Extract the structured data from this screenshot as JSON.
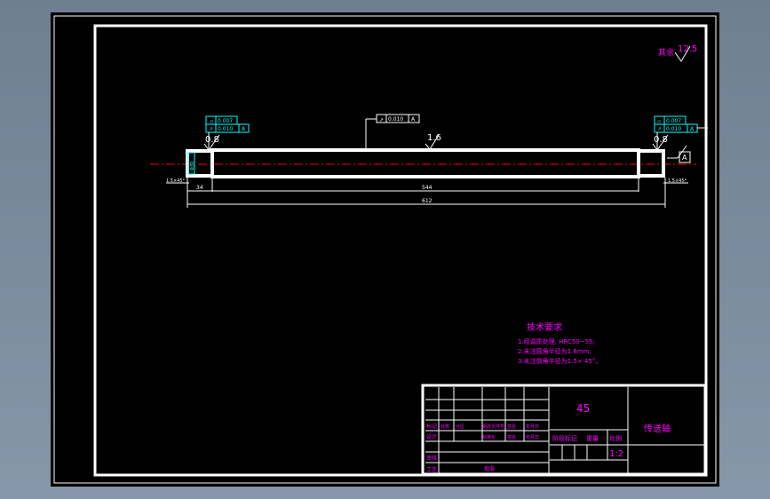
{
  "drawing": {
    "surface_note": {
      "label": "其余",
      "value": "12.5"
    },
    "tolerances": {
      "left_runout": "0.007",
      "left_cyl": "0.010",
      "left_datum": "A",
      "center_runout": "0.010",
      "center_datum": "A",
      "right_runout": "0.007",
      "right_cyl": "0.010",
      "right_datum": "A",
      "datum_label": "A"
    },
    "roughness": {
      "left": "0.8",
      "center": "1.6",
      "right": "0.8"
    },
    "dimensions": {
      "left_len": "34",
      "body_len": "544",
      "total_len": "612",
      "left_chamfer": "1.5×45°",
      "right_chamfer": "1.5×45°",
      "left_dia": "Φ30"
    }
  },
  "tech_requirements": {
    "title": "技术要求",
    "items": [
      "1.经调质处理,  HRC50~55;",
      "2.未注圆角半径为1.6mm;",
      "3.未注倒角半径为1.5× 45°。"
    ]
  },
  "title_block": {
    "material": "45",
    "part_name": "传送轴",
    "scale": "1:2",
    "row_labels": [
      "标记",
      "设计",
      "审核",
      "工艺"
    ],
    "approve_label": "批准",
    "cols_top": [
      "处数",
      "分区",
      "更改文件号",
      "签名",
      "年月日"
    ],
    "cols_mid": [
      "标准化",
      "签名",
      "年月日"
    ],
    "stage_mark": "阶段标记",
    "weight": "重量",
    "ratio_label": "比例"
  },
  "colors": {
    "outline": "#ffffff",
    "text": "#ff00ff",
    "dim": "#ffffff",
    "annot": "#00ffff",
    "center": "#ff0000",
    "background": "#000000"
  }
}
